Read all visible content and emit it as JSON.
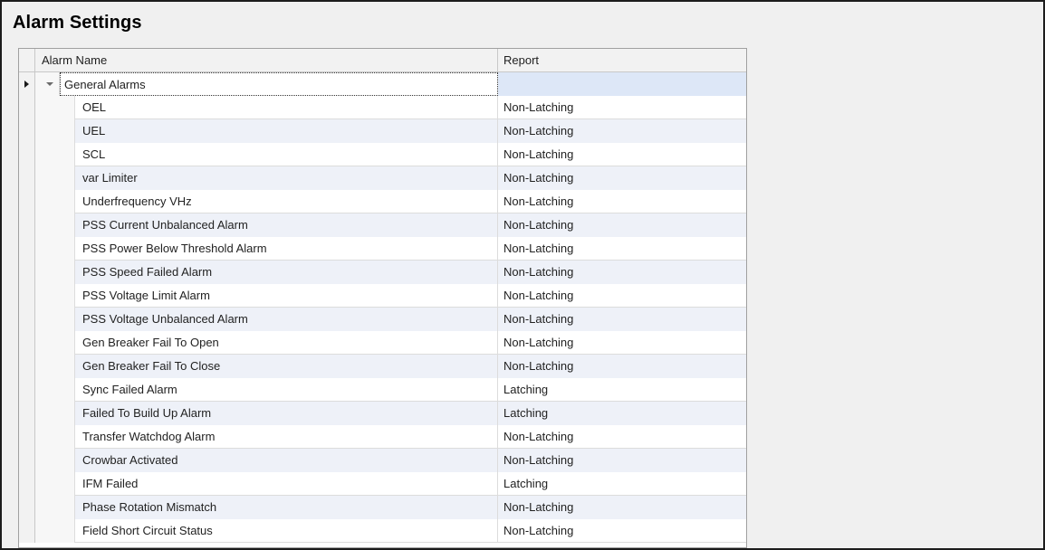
{
  "title": "Alarm Settings",
  "grid": {
    "columns": {
      "name": "Alarm Name",
      "report": "Report"
    },
    "group": {
      "label": "General Alarms",
      "report": ""
    },
    "rows": [
      {
        "name": "OEL",
        "report": "Non-Latching"
      },
      {
        "name": "UEL",
        "report": "Non-Latching"
      },
      {
        "name": "SCL",
        "report": "Non-Latching"
      },
      {
        "name": "var Limiter",
        "report": "Non-Latching"
      },
      {
        "name": "Underfrequency VHz",
        "report": "Non-Latching"
      },
      {
        "name": "PSS Current Unbalanced Alarm",
        "report": "Non-Latching"
      },
      {
        "name": "PSS Power Below Threshold Alarm",
        "report": "Non-Latching"
      },
      {
        "name": "PSS Speed Failed Alarm",
        "report": "Non-Latching"
      },
      {
        "name": "PSS Voltage Limit Alarm",
        "report": "Non-Latching"
      },
      {
        "name": "PSS Voltage Unbalanced Alarm",
        "report": "Non-Latching"
      },
      {
        "name": "Gen Breaker Fail To Open",
        "report": "Non-Latching"
      },
      {
        "name": "Gen Breaker Fail To Close",
        "report": "Non-Latching"
      },
      {
        "name": "Sync Failed Alarm",
        "report": "Latching"
      },
      {
        "name": "Failed To Build Up Alarm",
        "report": "Latching"
      },
      {
        "name": "Transfer Watchdog Alarm",
        "report": "Non-Latching"
      },
      {
        "name": "Crowbar Activated",
        "report": "Non-Latching"
      },
      {
        "name": "IFM Failed",
        "report": "Latching"
      },
      {
        "name": "Phase Rotation Mismatch",
        "report": "Non-Latching"
      },
      {
        "name": "Field Short Circuit Status",
        "report": "Non-Latching"
      }
    ]
  },
  "icons": {
    "current_row": "row-pointer-icon",
    "expand": "chevron-down-icon",
    "scroll_up": "scroll-up-arrow-icon",
    "scroll_down": "scroll-down-arrow-icon"
  },
  "colors": {
    "alt_row": "#eef1f8",
    "selected_report": "#dde7f7"
  }
}
